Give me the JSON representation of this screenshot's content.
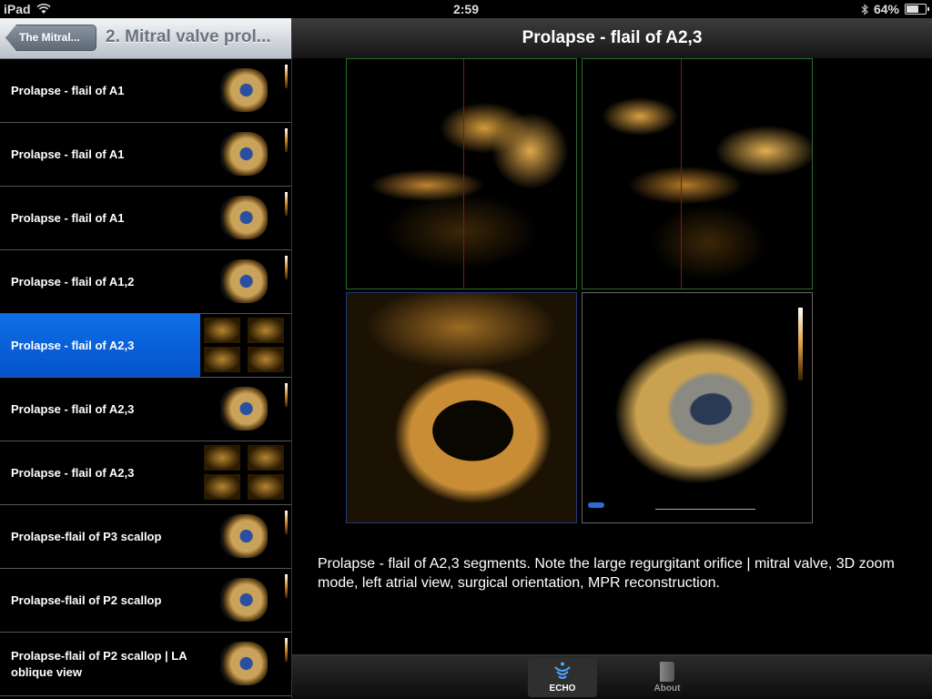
{
  "status": {
    "device": "iPad",
    "time": "2:59",
    "battery_text": "64%",
    "battery_level": 0.64
  },
  "left_nav": {
    "back_label": "The Mitral...",
    "title": "2. Mitral valve prol..."
  },
  "list_items": [
    {
      "label": "Prolapse - flail of A1",
      "selected": false
    },
    {
      "label": "Prolapse - flail of A1",
      "selected": false
    },
    {
      "label": "Prolapse - flail of A1",
      "selected": false
    },
    {
      "label": "Prolapse - flail of A1,2",
      "selected": false
    },
    {
      "label": "Prolapse - flail of A2,3",
      "selected": true
    },
    {
      "label": "Prolapse - flail of A2,3",
      "selected": false
    },
    {
      "label": "Prolapse - flail of A2,3",
      "selected": false
    },
    {
      "label": "Prolapse-flail of P3 scallop",
      "selected": false
    },
    {
      "label": "Prolapse-flail of P2 scallop",
      "selected": false
    },
    {
      "label": "Prolapse-flail of P2 scallop | LA oblique view",
      "selected": false
    }
  ],
  "detail": {
    "title": "Prolapse - flail of A2,3",
    "caption": "Prolapse - flail of A2,3 segments. Note the large regurgitant orifice | mitral valve, 3D zoom mode, left atrial view, surgical orientation, MPR reconstruction."
  },
  "tabs": [
    {
      "label": "ECHO",
      "icon": "echo-wave-icon",
      "active": true
    },
    {
      "label": "About",
      "icon": "book-icon",
      "active": false
    }
  ],
  "colors": {
    "selection": "#0a63de",
    "echo_tint": "#c88d35"
  }
}
